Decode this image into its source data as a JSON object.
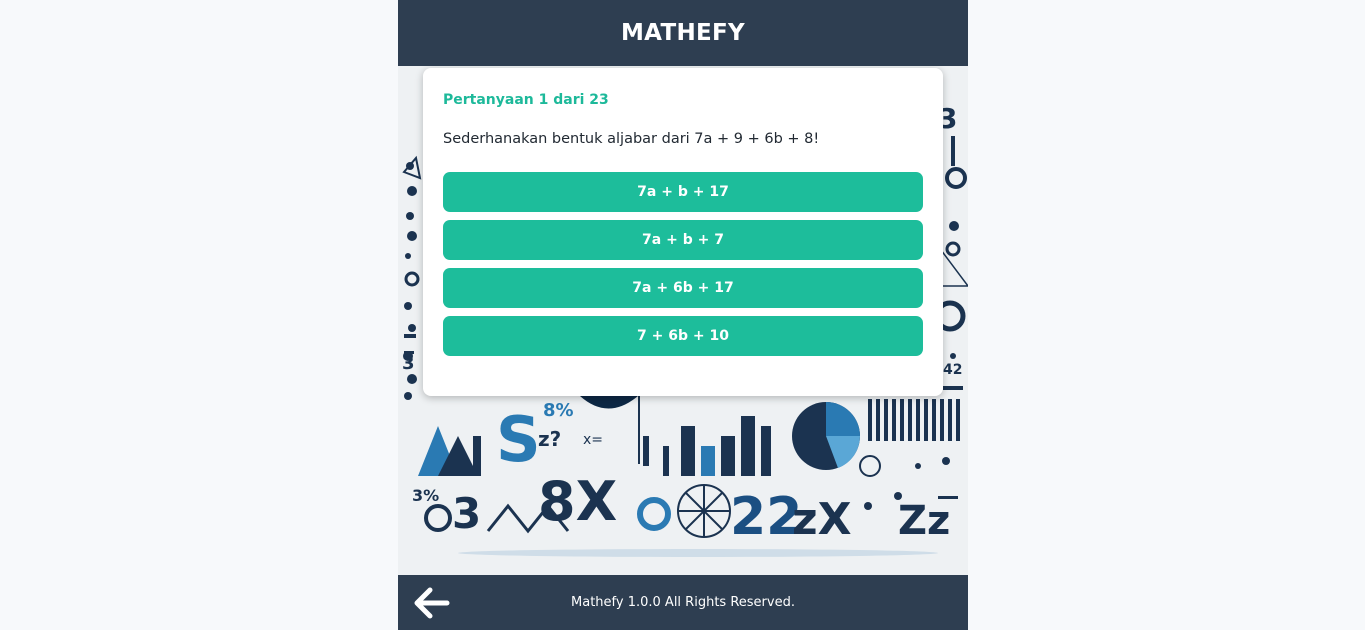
{
  "header": {
    "title": "MATHEFY"
  },
  "quiz": {
    "counter": "Pertanyaan 1 dari 23",
    "question": "Sederhanakan bentuk aljabar dari 7a + 9 + 6b + 8!",
    "options": [
      {
        "label": "7a + b + 17"
      },
      {
        "label": "7a + b + 7"
      },
      {
        "label": "7a + 6b + 17"
      },
      {
        "label": "7 + 6b + 10"
      }
    ]
  },
  "footer": {
    "copyright": "Mathefy 1.0.0 All Rights Reserved.",
    "back_icon": "arrow-left-icon"
  },
  "background": {
    "glyphs": [
      "S",
      "8X",
      "2ZzX",
      "Zz",
      "3",
      "8%",
      "z?",
      "x="
    ]
  },
  "colors": {
    "header": "#2e3e51",
    "accent": "#1dbd9b",
    "counter": "#1db99a"
  }
}
